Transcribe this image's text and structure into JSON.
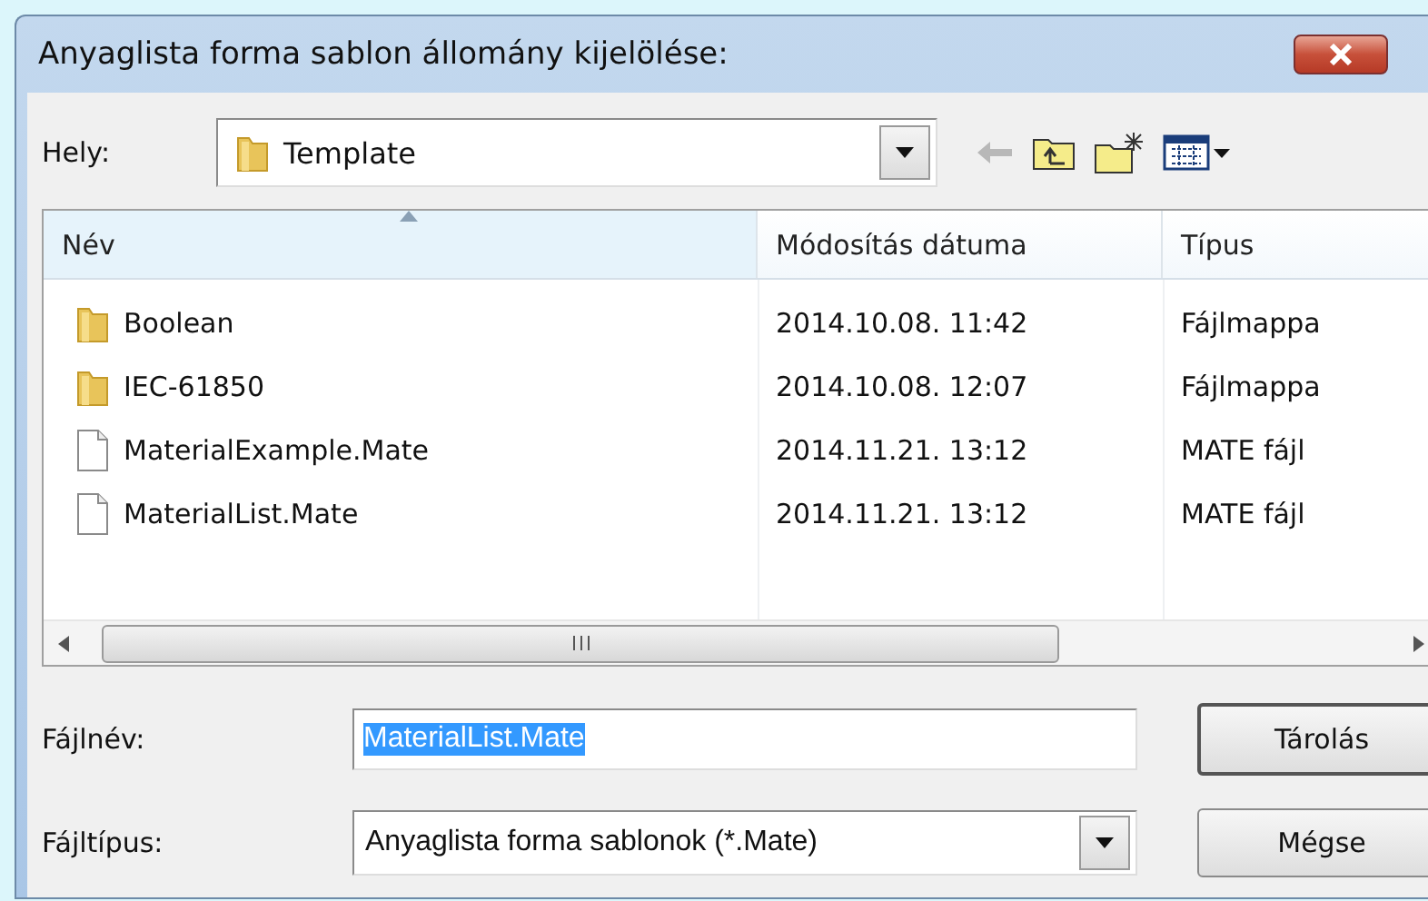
{
  "window": {
    "title": "Anyaglista forma sablon állomány kijelölése:"
  },
  "location": {
    "label": "Hely:",
    "value": "Template"
  },
  "file_list": {
    "columns": [
      {
        "label": "Név",
        "sorted": true
      },
      {
        "label": "Módosítás dátuma",
        "sorted": false
      },
      {
        "label": "Típus",
        "sorted": false
      }
    ],
    "rows": [
      {
        "kind": "folder",
        "name": "Boolean",
        "date": "2014.10.08. 11:42",
        "type": "Fájlmappa",
        "selected": false
      },
      {
        "kind": "folder",
        "name": "IEC-61850",
        "date": "2014.10.08. 12:07",
        "type": "Fájlmappa",
        "selected": false
      },
      {
        "kind": "file",
        "name": "MaterialExample.Mate",
        "date": "2014.11.21. 13:12",
        "type": "MATE fájl",
        "selected": false
      },
      {
        "kind": "file",
        "name": "MaterialList.Mate",
        "date": "2014.11.21. 13:12",
        "type": "MATE fájl",
        "selected": false
      }
    ]
  },
  "file_name": {
    "label": "Fájlnév:",
    "value": "MaterialList.Mate",
    "text_selected": true
  },
  "file_type": {
    "label": "Fájltípus:",
    "value": "Anyaglista forma sablonok (*.Mate)"
  },
  "buttons": [
    {
      "label": "Tárolás",
      "default": true
    },
    {
      "label": "Mégse",
      "default": false
    }
  ]
}
